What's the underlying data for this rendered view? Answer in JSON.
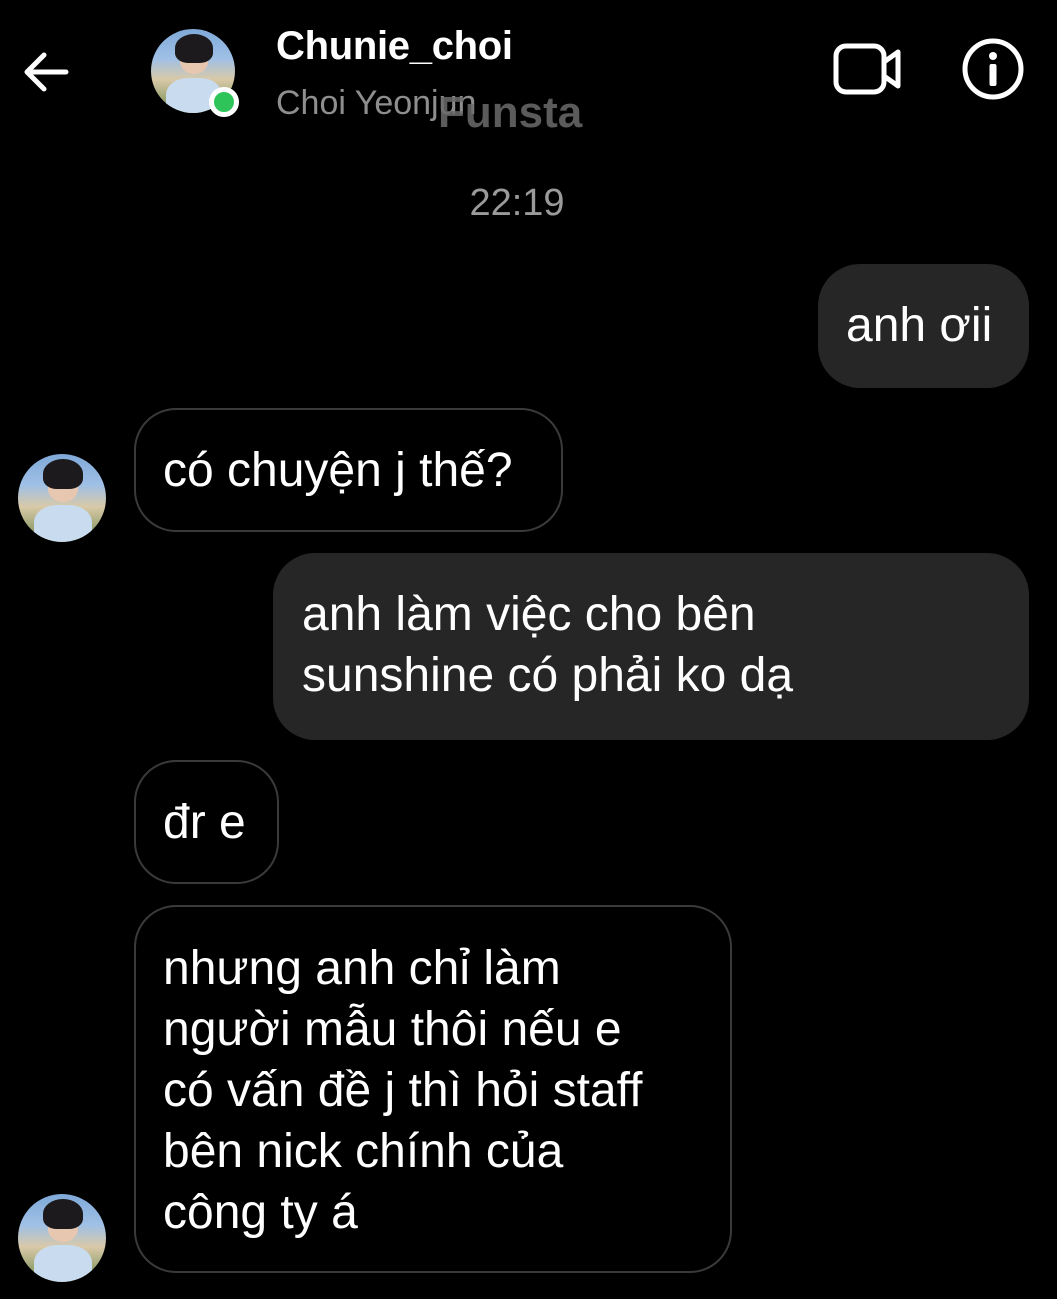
{
  "header": {
    "back_icon": "arrow-left-icon",
    "username": "Chunie_choi",
    "display_name": "Choi Yeonjun",
    "watermark": "Funsta",
    "video_icon": "video-camera-icon",
    "info_icon": "info-circle-icon",
    "online_status_color": "#2fc45a"
  },
  "chat": {
    "timestamp": "22:19",
    "messages": [
      {
        "direction": "outgoing",
        "text": "anh ơii"
      },
      {
        "direction": "incoming",
        "text": "có chuyện j thế?"
      },
      {
        "direction": "outgoing",
        "text": "anh làm việc cho bên\nsunshine có phải ko dạ"
      },
      {
        "direction": "incoming",
        "text": "đr e"
      },
      {
        "direction": "incoming",
        "text": "nhưng anh chỉ làm\nngười mẫu thôi nếu e\ncó vấn đề j thì hỏi staff\nbên nick chính của\ncông ty á"
      }
    ]
  },
  "colors": {
    "background": "#000000",
    "outgoing_bubble": "#262626",
    "incoming_border": "#3a3a3a",
    "secondary_text": "#8e8e8e"
  }
}
